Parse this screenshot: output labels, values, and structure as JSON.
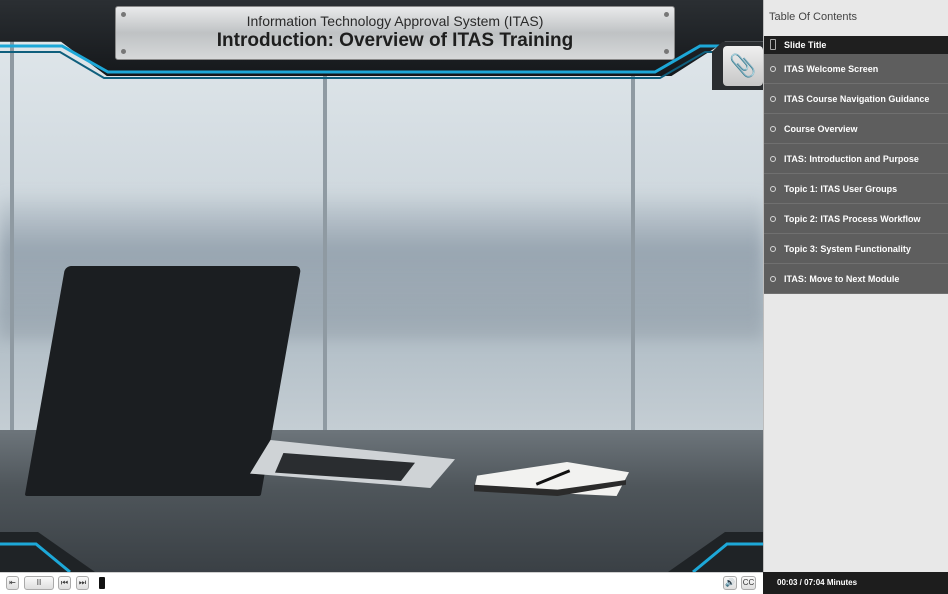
{
  "header": {
    "subtitle": "Information Technology Approval System (ITAS)",
    "title": "Introduction: Overview of ITAS Training"
  },
  "attachments": {
    "icon": "paperclip-icon"
  },
  "sidebar": {
    "heading": "Table Of Contents",
    "column_title": "Slide Title",
    "items": [
      {
        "label": "ITAS Welcome Screen"
      },
      {
        "label": "ITAS Course Navigation Guidance"
      },
      {
        "label": "Course Overview"
      },
      {
        "label": "ITAS: Introduction and Purpose"
      },
      {
        "label": "Topic 1: ITAS User Groups"
      },
      {
        "label": "Topic 2: ITAS Process Workflow"
      },
      {
        "label": "Topic 3: System Functionality"
      },
      {
        "label": "ITAS: Move to Next Module"
      }
    ]
  },
  "player": {
    "exit_icon": "exit-icon",
    "pause_label": "II",
    "prev_icon": "previous-icon",
    "next_icon": "next-icon",
    "volume_icon": "volume-icon",
    "cc_label": "CC",
    "time": "00:03 / 07:04 Minutes"
  },
  "colors": {
    "accent_glow": "#1da8d8",
    "toc_item_bg": "#5e5e5e",
    "toc_title_bg": "#1f1f1f"
  }
}
